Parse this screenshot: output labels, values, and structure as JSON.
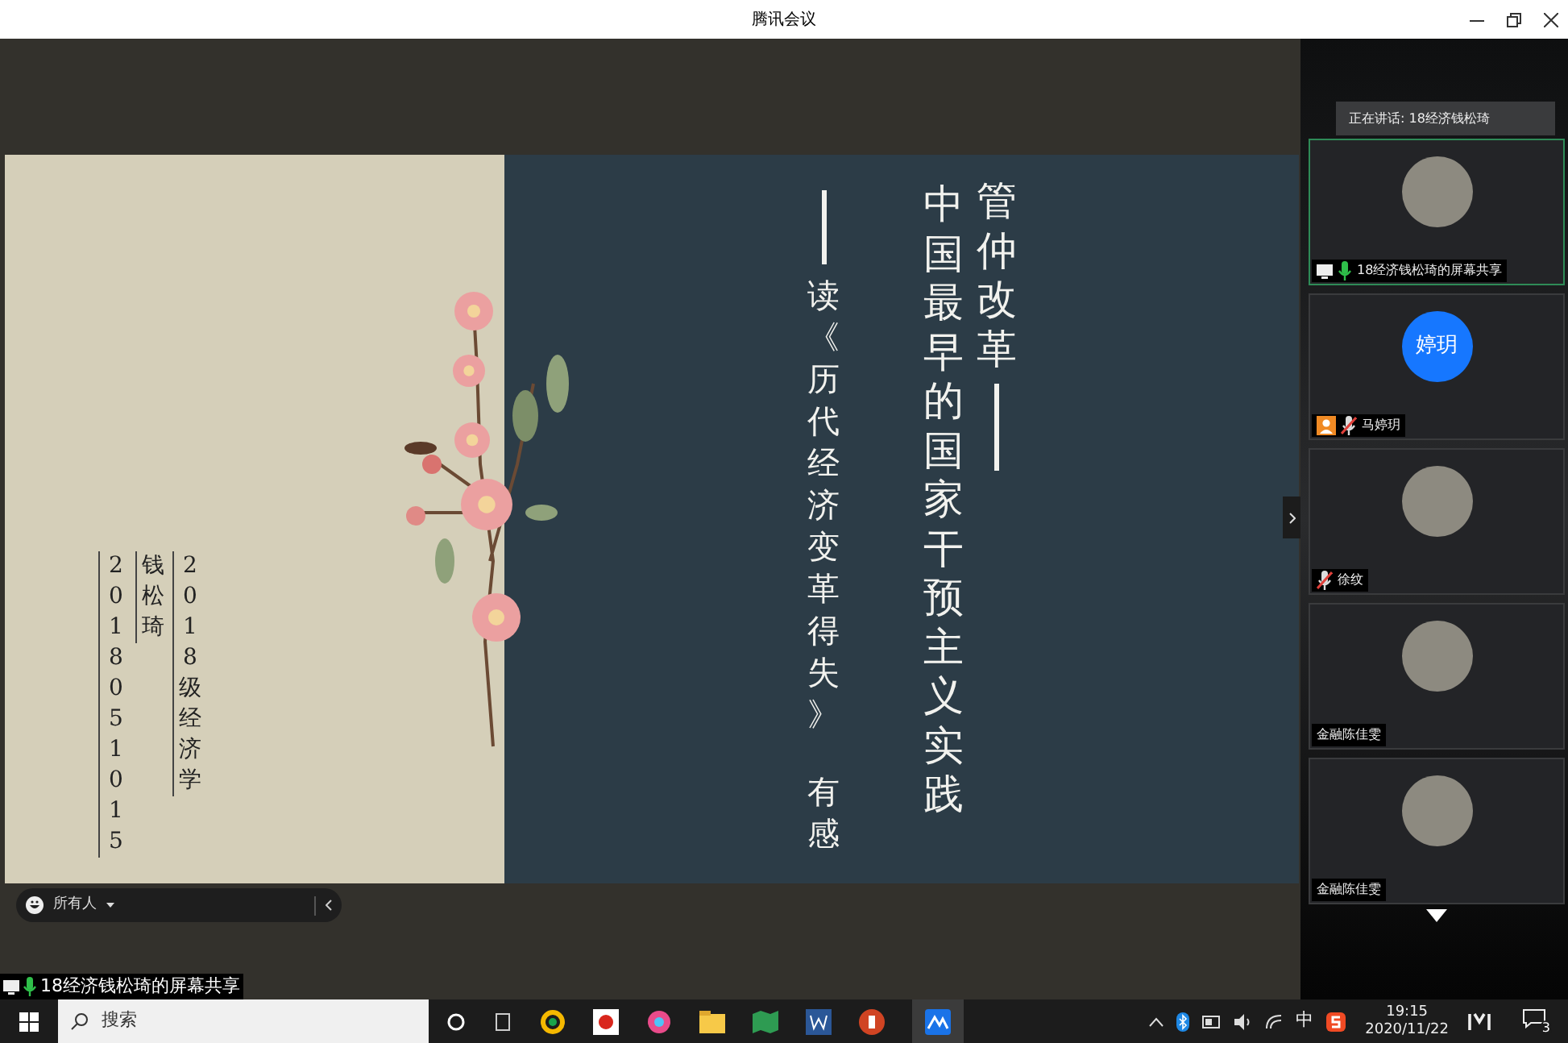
{
  "window": {
    "title": "腾讯会议"
  },
  "slide": {
    "title": "管仲改革",
    "headline": "中国最早的国家干预主义实践",
    "subtitle": [
      "读《历代经济变革得失》",
      "有感"
    ],
    "author_info": [
      "2018051015",
      "钱松琦",
      "2018级经济学"
    ]
  },
  "chat_bar": {
    "recipient": "所有人"
  },
  "share_label": "18经济钱松琦的屏幕共享",
  "speaking": "正在讲话: 18经济钱松琦",
  "participants": [
    {
      "name": "18经济钱松琦的屏幕共享",
      "kind": "photo",
      "selected": true,
      "mic_visible": true,
      "mic_muted": false,
      "sharing": true,
      "host": false
    },
    {
      "name": "马婷玥",
      "kind": "initials",
      "initials": "婷玥",
      "selected": false,
      "mic_visible": true,
      "mic_muted": true,
      "sharing": false,
      "host": true
    },
    {
      "name": "徐纹",
      "kind": "photo",
      "selected": false,
      "mic_visible": true,
      "mic_muted": true,
      "sharing": false,
      "host": false
    },
    {
      "name": "金融陈佳雯",
      "kind": "photo",
      "selected": false,
      "mic_visible": false,
      "sharing": false,
      "host": false
    },
    {
      "name": "金融陈佳雯",
      "kind": "photo",
      "selected": false,
      "mic_visible": false,
      "sharing": false,
      "host": false
    }
  ],
  "taskbar": {
    "search_placeholder": "搜索",
    "ime": "中",
    "time": "19:15",
    "date": "2020/11/22",
    "notification_count": "3"
  }
}
